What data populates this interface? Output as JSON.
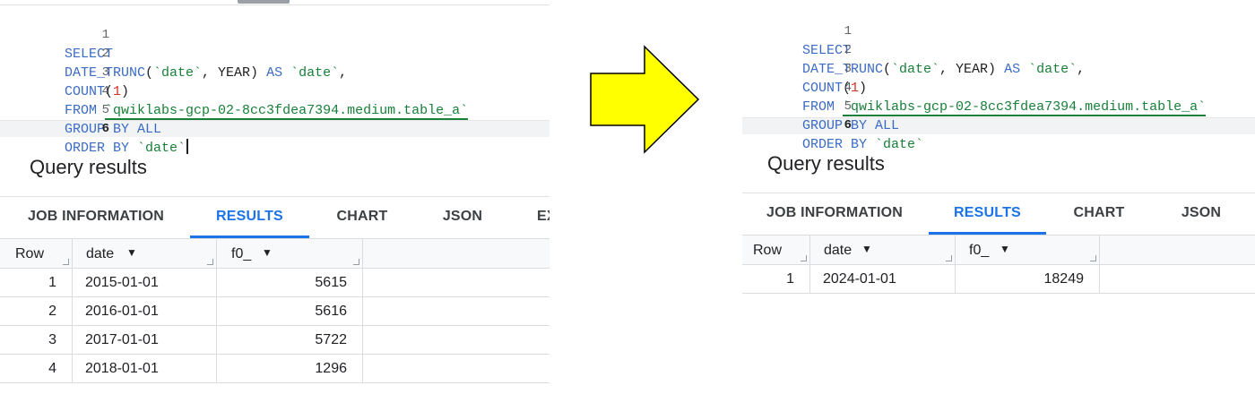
{
  "left": {
    "code_lines": [
      {
        "n": "1",
        "text": "SELECT"
      },
      {
        "n": "2",
        "text": "DATE_TRUNC(`date`, YEAR) AS `date`,"
      },
      {
        "n": "3",
        "text": "COUNT(1)"
      },
      {
        "n": "4",
        "text": "FROM `qwiklabs-gcp-02-8cc3fdea7394.medium.table_a`"
      },
      {
        "n": "5",
        "text": "GROUP BY ALL"
      },
      {
        "n": "6",
        "text": "ORDER BY `date`"
      }
    ],
    "results_title": "Query results",
    "tabs": [
      "JOB INFORMATION",
      "RESULTS",
      "CHART",
      "JSON",
      "EX"
    ],
    "columns": [
      "Row",
      "date",
      "f0_"
    ],
    "rows": [
      {
        "row": "1",
        "date": "2015-01-01",
        "f0_": "5615"
      },
      {
        "row": "2",
        "date": "2016-01-01",
        "f0_": "5616"
      },
      {
        "row": "3",
        "date": "2017-01-01",
        "f0_": "5722"
      },
      {
        "row": "4",
        "date": "2018-01-01",
        "f0_": "1296"
      }
    ]
  },
  "right": {
    "code_lines": [
      {
        "n": "1",
        "text": "SELECT"
      },
      {
        "n": "2",
        "text": "DATE_TRUNC(`date`, YEAR) AS `date`,"
      },
      {
        "n": "3",
        "text": "COUNT(1)"
      },
      {
        "n": "4",
        "text": "FROM `qwiklabs-gcp-02-8cc3fdea7394.medium.table_a`"
      },
      {
        "n": "5",
        "text": "GROUP BY ALL"
      },
      {
        "n": "6",
        "text": "ORDER BY `date`"
      }
    ],
    "results_title": "Query results",
    "tabs": [
      "JOB INFORMATION",
      "RESULTS",
      "CHART",
      "JSON"
    ],
    "columns": [
      "Row",
      "date",
      "f0_"
    ],
    "rows": [
      {
        "row": "1",
        "date": "2024-01-01",
        "f0_": "18249"
      }
    ]
  },
  "colors": {
    "arrow_fill": "#ffff00",
    "keyword": "#3b6bc4",
    "string": "#188038",
    "number": "#d93025",
    "active_tab": "#1a73e8"
  },
  "icons": {
    "arrow": "right-arrow-icon",
    "sort": "caret-down-icon"
  }
}
